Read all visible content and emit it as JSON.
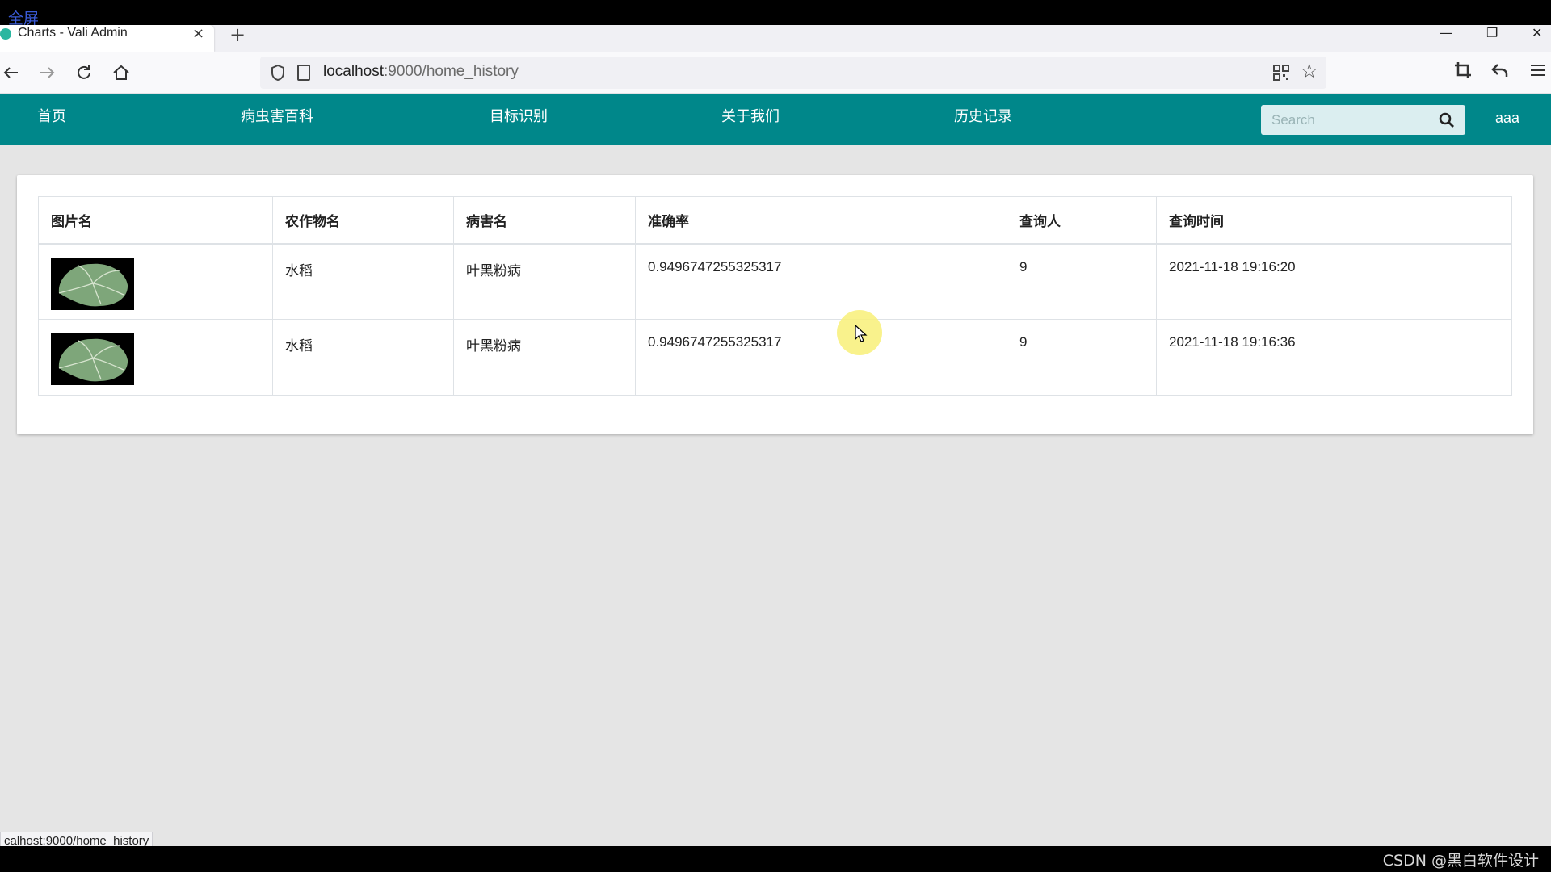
{
  "overlay": {
    "fullscreen_label": "全屏"
  },
  "browser": {
    "tab_title": "Charts - Vali Admin",
    "tab_close": "×",
    "new_tab": "+",
    "window_controls": [
      "—",
      "❐",
      "✕"
    ],
    "url_host": "localhost",
    "url_path": ":9000/home_history",
    "status_link": "calhost:9000/home_history"
  },
  "header": {
    "menu": [
      "首页",
      "病虫害百科",
      "目标识别",
      "关于我们",
      "历史记录"
    ],
    "search_placeholder": "Search",
    "user": "aaa"
  },
  "table": {
    "columns": [
      "图片名",
      "农作物名",
      "病害名",
      "准确率",
      "查询人",
      "查询时间"
    ],
    "rows": [
      {
        "crop": "水稻",
        "disease": "叶黑粉病",
        "accuracy": "0.9496747255325317",
        "user": "9",
        "time": "2021-11-18 19:16:20"
      },
      {
        "crop": "水稻",
        "disease": "叶黑粉病",
        "accuracy": "0.9496747255325317",
        "user": "9",
        "time": "2021-11-18 19:16:36"
      }
    ]
  },
  "watermark": "CSDN @黑白软件设计",
  "colors": {
    "header_bg": "#00878a",
    "page_bg": "#e5e5e5"
  }
}
